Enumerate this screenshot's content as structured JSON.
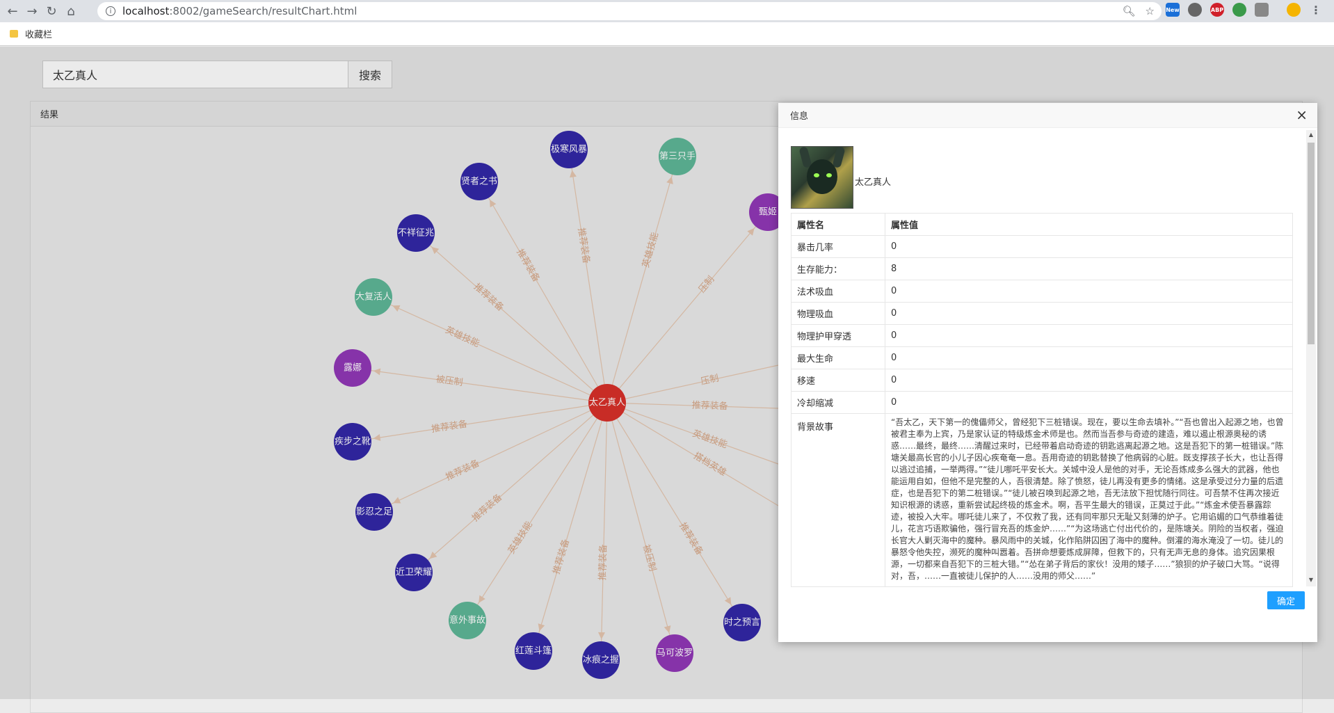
{
  "browser": {
    "url_host": "localhost",
    "url_path": ":8002/gameSearch/resultChart.html",
    "bookmark_folder": "收藏栏",
    "ext_new": "New",
    "ext_abp": "ABP"
  },
  "search": {
    "query": "太乙真人",
    "button": "搜索"
  },
  "result": {
    "title": "结果"
  },
  "graph": {
    "center": "太乙真人",
    "center_color": "#d9302a",
    "nodes": [
      {
        "label": "极寒风暴",
        "color": "#3228a8",
        "edge": "推荐装备"
      },
      {
        "label": "第三只手",
        "color": "#5fb898",
        "edge": "英雄技能"
      },
      {
        "label": "甄姬",
        "color": "#9238b8",
        "edge": "压制"
      },
      {
        "label": "贤者之书",
        "color": "#3228a8",
        "edge": "推荐装备"
      },
      {
        "label": "不祥征兆",
        "color": "#3228a8",
        "edge": "推荐装备"
      },
      {
        "label": "大复活人",
        "color": "#5fb898",
        "edge": "英雄技能"
      },
      {
        "label": "露娜",
        "color": "#9238b8",
        "edge": "被压制"
      },
      {
        "label": "疾步之靴",
        "color": "#3228a8",
        "edge": "推荐装备"
      },
      {
        "label": "影忍之足",
        "color": "#3228a8",
        "edge": "推荐装备"
      },
      {
        "label": "近卫荣耀",
        "color": "#3228a8",
        "edge": "推荐装备"
      },
      {
        "label": "意外事故",
        "color": "#5fb898",
        "edge": "英雄技能"
      },
      {
        "label": "红莲斗篷",
        "color": "#3228a8",
        "edge": "推荐装备"
      },
      {
        "label": "冰痕之握",
        "color": "#3228a8",
        "edge": "推荐装备"
      },
      {
        "label": "马可波罗",
        "color": "#9238b8",
        "edge": "被压制"
      },
      {
        "label": "时之预言",
        "color": "#3228a8",
        "edge": "推荐装备"
      }
    ],
    "extra_edges": [
      "压制",
      "推荐装备",
      "英雄技能",
      "搭档英雄"
    ]
  },
  "dialog": {
    "title": "信息",
    "hero_name": "太乙真人",
    "table_header": {
      "key": "属性名",
      "value": "属性值"
    },
    "rows": [
      {
        "key": "暴击几率",
        "value": "0"
      },
      {
        "key": "生存能力：",
        "value": "8"
      },
      {
        "key": "法术吸血",
        "value": "0"
      },
      {
        "key": "物理吸血",
        "value": "0"
      },
      {
        "key": "物理护甲穿透",
        "value": "0"
      },
      {
        "key": "最大生命",
        "value": "0"
      },
      {
        "key": "移速",
        "value": "0"
      },
      {
        "key": "冷却缩减",
        "value": "0"
      }
    ],
    "story_key": "背景故事",
    "story": "“吾太乙，天下第一的傀儡师父，曾经犯下三桩错误。现在，要以生命去填补。”“吾也曾出入起源之地，也曾被君主奉为上宾，乃是家认证的特级炼金术师是也。然而当吾参与奇迹的建造，难以遏止根源奥秘的诱惑……最终，最终……清醒过来时，已经带着启动奇迹的钥匙逃离起源之地。这是吾犯下的第一桩错误。”陈塘关最高长官的小儿子因心疾奄奄一息。吾用奇迹的钥匙替换了他病弱的心脏。既支撑孩子长大，也让吾得以逃过追捕，一举两得。”“徒儿哪吒平安长大。关城中没人是他的对手，无论吾炼成多么强大的武器，他也能运用自如，但他不是完整的人，吾很清楚。除了愤怒，徒儿再没有更多的情绪。这是承受过分力量的后遗症，也是吾犯下的第二桩错误。”“徒儿被召唤到起源之地，吾无法放下担忧随行同往。可吾禁不住再次接近知识根源的诱惑，重新尝试起终极的炼金术。啊，吾平生最大的错误，正莫过于此。”“炼金术使吾暴露踪迹，被投入大牢。哪吒徒儿来了，不仅救了我，还有同牢那只无耻又刻薄的炉子。它用谄媚的口气恭维着徒儿，花言巧语欺骗他，强行冒充吾的炼金炉……”“为这场逃亡付出代价的，是陈塘关。阴险的当权者，强迫长官大人剿灭海中的魔种。暴风雨中的关城，化作陷阱囚困了海中的魔种。倒灌的海水淹没了一切。徒儿的暴怒令他失控，濒死的魔种叫嚣着。吾拼命想要炼成屏障，但救下的，只有无声无息的身体。追究因果根源，一切都来自吾犯下的三桩大错。”“怂在弟子背后的家伙！没用的矮子……”狼狈的炉子破口大骂。“说得对，吾，……一直被徒儿保护的人……没用的师父……”",
    "ok_button": "确定"
  }
}
